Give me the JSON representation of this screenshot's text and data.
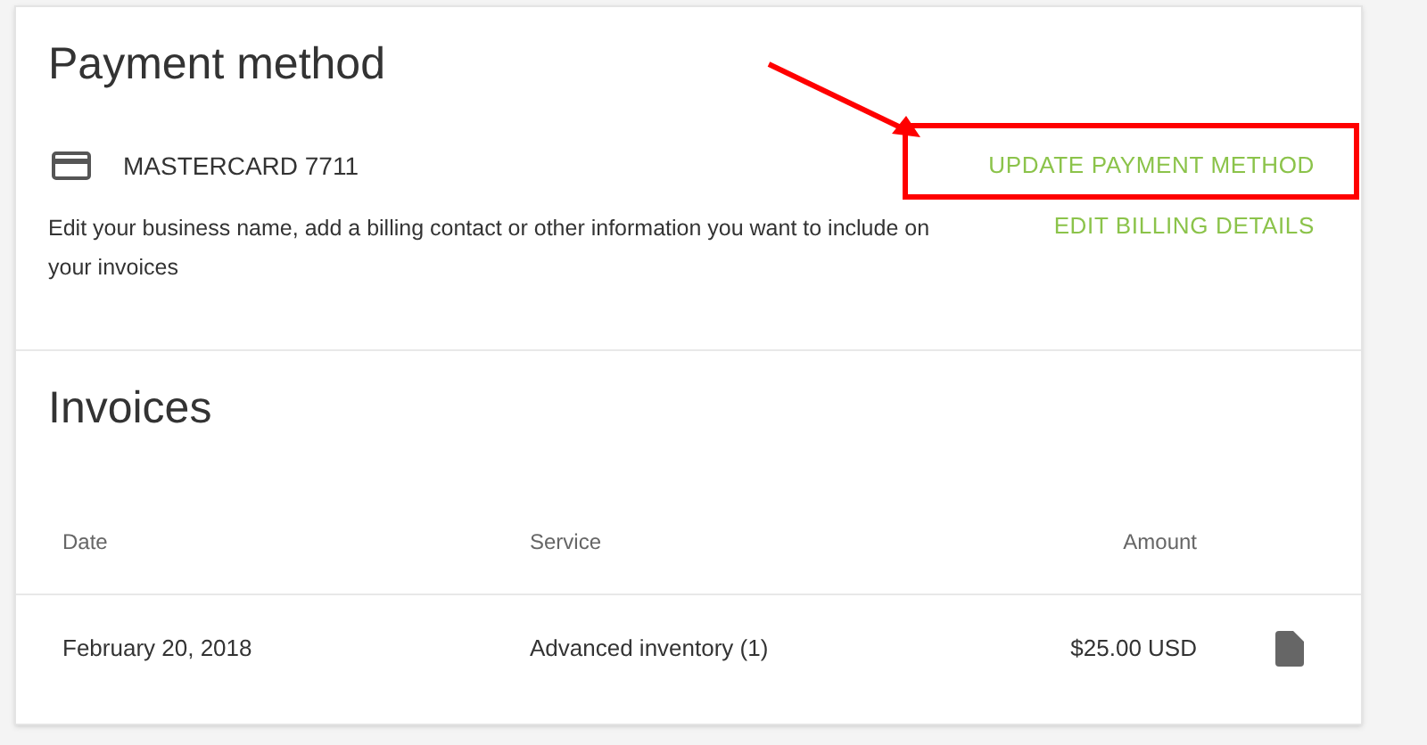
{
  "payment": {
    "title": "Payment method",
    "card": "MASTERCARD 7711",
    "update_action": {
      "label": "UPDATE PAYMENT METHOD",
      "highlighted": true
    },
    "description": "Edit your business name, add a billing contact or other information you want to include on your invoices",
    "edit_action": "EDIT BILLING DETAILS"
  },
  "invoices": {
    "title": "Invoices",
    "columns": [
      "Date",
      "Service",
      "Amount"
    ],
    "rows": [
      {
        "date": "February 20, 2018",
        "service": "Advanced inventory (1)",
        "amount": "$25.00 USD"
      }
    ]
  }
}
